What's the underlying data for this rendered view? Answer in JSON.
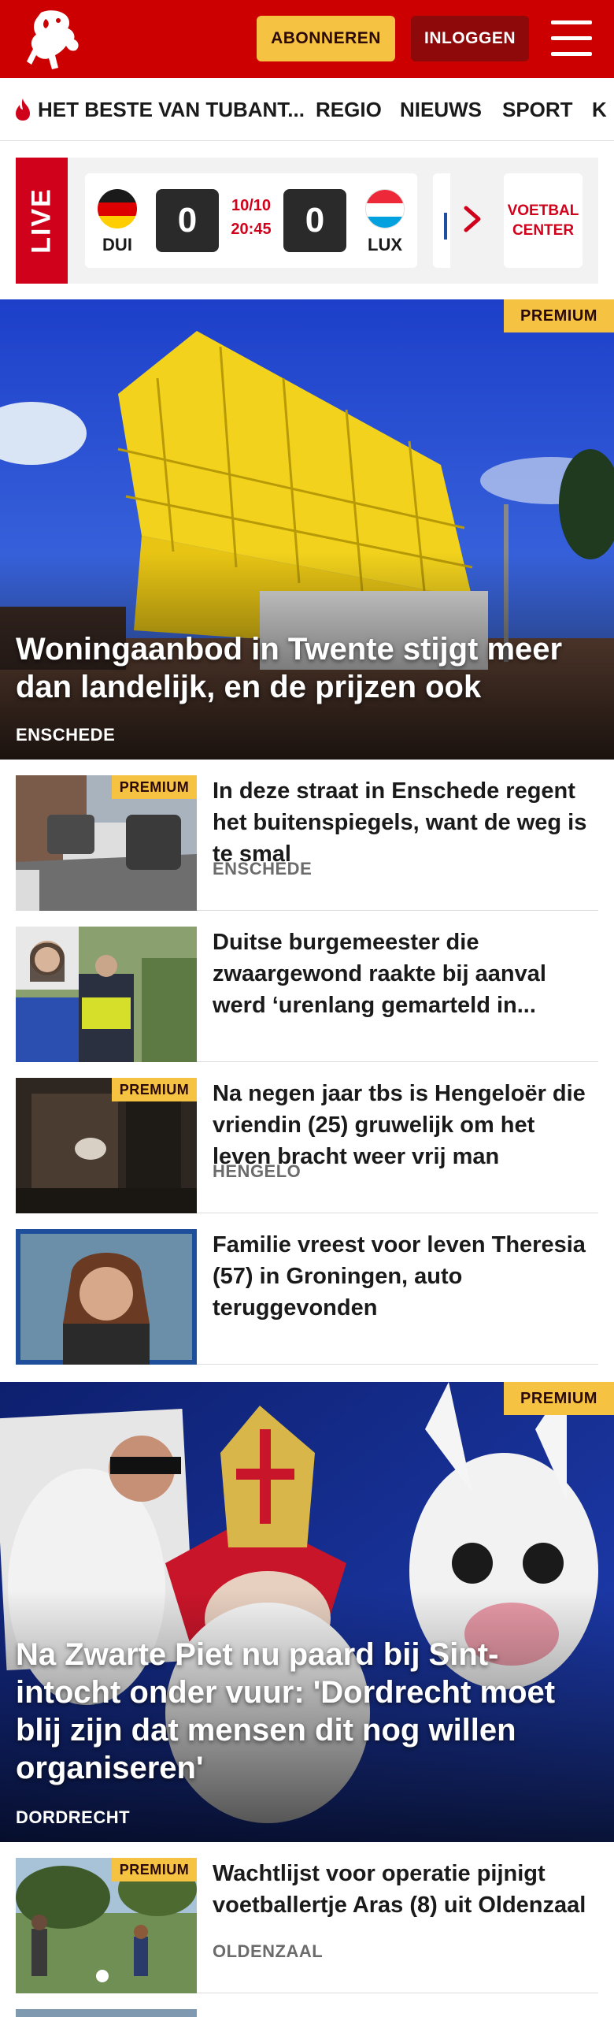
{
  "header": {
    "subscribe_label": "ABONNEREN",
    "login_label": "INLOGGEN",
    "brand_color": "#cc0000"
  },
  "nav": {
    "items": [
      "HET BESTE VAN TUBANT...",
      "REGIO",
      "NIEUWS",
      "SPORT",
      "K"
    ]
  },
  "live": {
    "label": "LIVE",
    "match": {
      "home_team": "DUI",
      "away_team": "LUX",
      "home_score": "0",
      "away_score": "0",
      "date": "10/10",
      "time": "20:45"
    },
    "center_label_line1": "VOETBAL",
    "center_label_line2": "CENTER"
  },
  "hero1": {
    "premium": "PREMIUM",
    "title": "Woningaanbod in Twente stijgt meer dan landelijk, en de prijzen ook",
    "location": "ENSCHEDE"
  },
  "articles": [
    {
      "premium": "PREMIUM",
      "title": "In deze straat in Enschede regent het buitenspiegels, want de weg is te smal",
      "location": "ENSCHEDE"
    },
    {
      "premium": "",
      "title": "Duitse burgemeester die zwaargewond raakte bij aanval werd ‘urenlang gemarteld in...",
      "location": ""
    },
    {
      "premium": "PREMIUM",
      "title": "Na negen jaar tbs is Hengeloër die vriendin (25) gruwelijk om het leven bracht weer vrij man",
      "location": "HENGELO"
    },
    {
      "premium": "",
      "title": "Familie vreest voor leven Theresia (57) in Groningen, auto teruggevonden",
      "location": ""
    }
  ],
  "hero2": {
    "premium": "PREMIUM",
    "title": "Na Zwarte Piet nu paard bij Sint-intocht onder vuur: 'Dordrecht moet blij zijn dat mensen dit nog willen organiseren'",
    "location": "DORDRECHT"
  },
  "articles2": [
    {
      "premium": "PREMIUM",
      "title": "Wachtlijst voor operatie pijnigt voetballertje Aras (8) uit Oldenzaal",
      "location": "OLDENZAAL"
    }
  ]
}
